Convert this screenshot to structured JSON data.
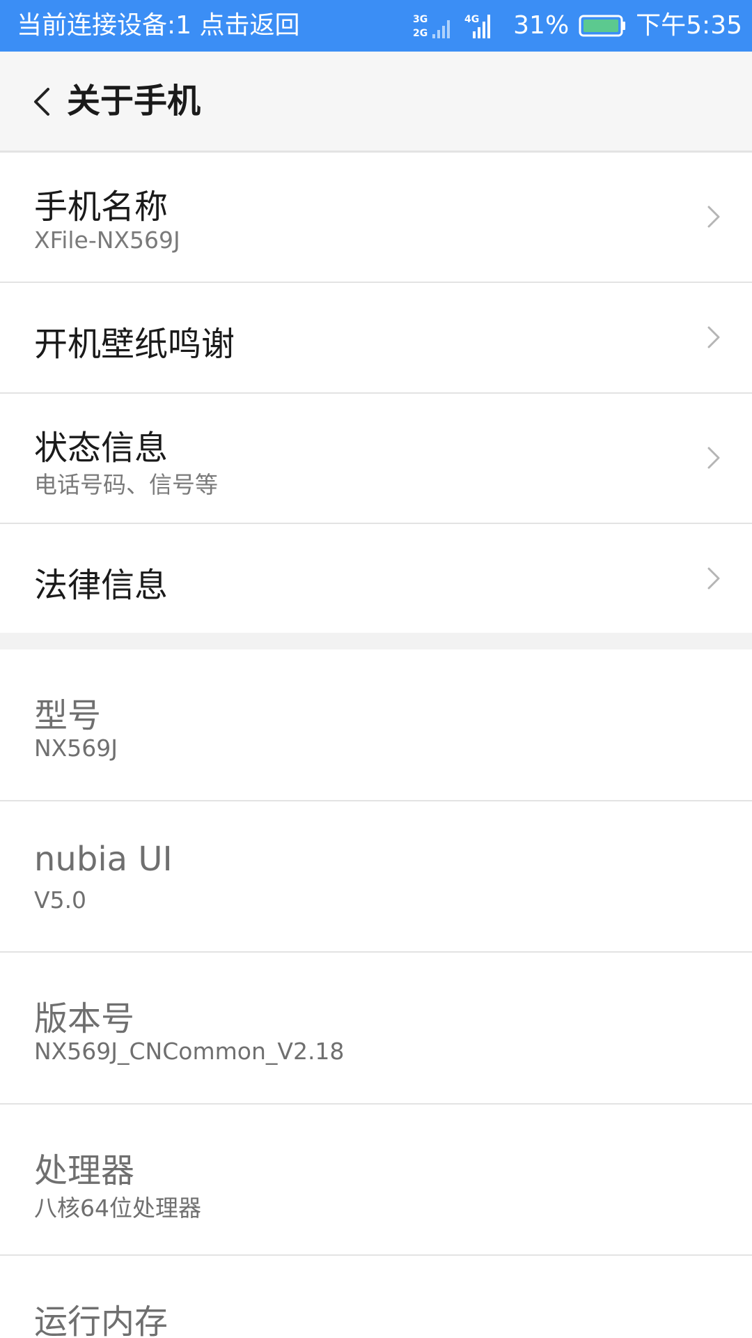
{
  "status_bar": {
    "connection_text": "当前连接设备:1 点击返回",
    "network_icon": "network-3g-2g-icon",
    "signal_icon": "signal-4g-icon",
    "battery_percent": "31%",
    "battery_level": 0.31,
    "time": "下午5:35",
    "background_color": "#3b8ef5"
  },
  "header": {
    "title": "关于手机",
    "back_icon": "chevron-left-icon"
  },
  "nav_items": [
    {
      "title": "手机名称",
      "subtitle": "XFile-NX569J"
    },
    {
      "title": "开机壁纸鸣谢"
    },
    {
      "title": "状态信息",
      "subtitle": "电话号码、信号等"
    },
    {
      "title": "法律信息"
    }
  ],
  "info_items": [
    {
      "title": "型号",
      "value": "NX569J"
    },
    {
      "title": "nubia UI",
      "value": "V5.0"
    },
    {
      "title": "版本号",
      "value": "NX569J_CNCommon_V2.18"
    },
    {
      "title": "处理器",
      "value": "八核64位处理器"
    },
    {
      "title": "运行内存"
    }
  ],
  "chevron_icon": "chevron-right-icon"
}
